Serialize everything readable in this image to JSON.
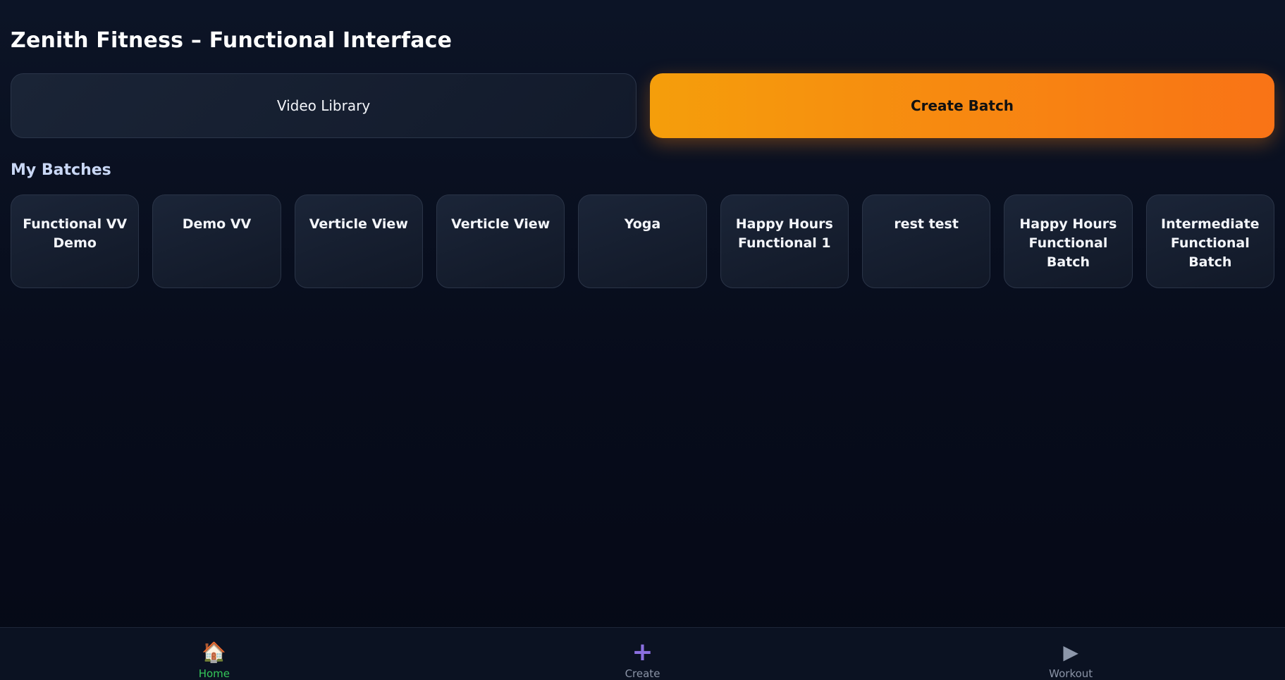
{
  "header": {
    "title": "Zenith Fitness – Functional Interface"
  },
  "actions": {
    "video_library_label": "Video Library",
    "create_batch_label": "Create Batch"
  },
  "batches": {
    "section_title": "My Batches",
    "items": [
      {
        "label": "Functional VV Demo"
      },
      {
        "label": "Demo VV"
      },
      {
        "label": "Verticle View"
      },
      {
        "label": "Verticle View"
      },
      {
        "label": "Yoga"
      },
      {
        "label": "Happy Hours Functional 1"
      },
      {
        "label": "rest test"
      },
      {
        "label": "Happy Hours Functional Batch"
      },
      {
        "label": "Intermediate Functional Batch"
      }
    ]
  },
  "nav": {
    "items": [
      {
        "label": "Home",
        "icon": "house-icon",
        "glyph": "🏠",
        "active": true
      },
      {
        "label": "Create",
        "icon": "plus-icon",
        "glyph": "+",
        "active": false
      },
      {
        "label": "Workout",
        "icon": "play-icon",
        "glyph": "▶",
        "active": false
      }
    ]
  },
  "colors": {
    "accent": "#f59e0b",
    "accent_end": "#f97316",
    "active_nav": "#34c759",
    "create_icon": "#8b6fe0"
  }
}
